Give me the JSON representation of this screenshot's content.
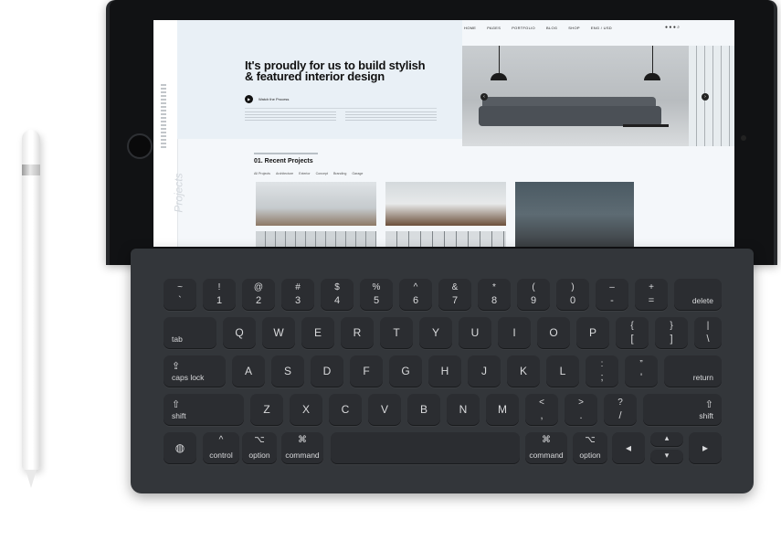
{
  "website": {
    "nav": [
      "HOME",
      "PAGES",
      "PORTFOLIO",
      "BLOG",
      "SHOP",
      "ENG / USD"
    ],
    "nav_icons": "● ● ●   ⌕",
    "hero_title": "It's proudly for us to build stylish & featured interior design",
    "watch_label": "Watch the Process",
    "play_symbol": "▶",
    "side_label": "Projects",
    "recent_title": "01. Recent Projects",
    "filters": [
      "All Projects",
      "Architecture",
      "Exterior",
      "Concept",
      "Branding",
      "Garage"
    ],
    "arrow_left": "‹",
    "arrow_right": "›"
  },
  "keyboard": {
    "row1": [
      {
        "top": "~",
        "bot": "`"
      },
      {
        "top": "!",
        "bot": "1"
      },
      {
        "top": "@",
        "bot": "2"
      },
      {
        "top": "#",
        "bot": "3"
      },
      {
        "top": "$",
        "bot": "4"
      },
      {
        "top": "%",
        "bot": "5"
      },
      {
        "top": "^",
        "bot": "6"
      },
      {
        "top": "&",
        "bot": "7"
      },
      {
        "top": "*",
        "bot": "8"
      },
      {
        "top": "(",
        "bot": "9"
      },
      {
        "top": ")",
        "bot": "0"
      },
      {
        "top": "–",
        "bot": "-"
      },
      {
        "top": "+",
        "bot": "="
      }
    ],
    "delete": "delete",
    "tab": "tab",
    "row2": [
      "Q",
      "W",
      "E",
      "R",
      "T",
      "Y",
      "U",
      "I",
      "O",
      "P"
    ],
    "brace": {
      "top": "{",
      "bot": "["
    },
    "bracket": {
      "top": "}",
      "bot": "]"
    },
    "pipe": {
      "top": "|",
      "bot": "\\"
    },
    "caps_symbol": "⇪",
    "caps": "caps lock",
    "row3": [
      "A",
      "S",
      "D",
      "F",
      "G",
      "H",
      "J",
      "K",
      "L"
    ],
    "colon": {
      "top": ":",
      "bot": ";"
    },
    "quote": {
      "top": "”",
      "bot": "'"
    },
    "return": "return",
    "shift_symbol": "⇧",
    "shift": "shift",
    "row4": [
      "Z",
      "X",
      "C",
      "V",
      "B",
      "N",
      "M"
    ],
    "lt": {
      "top": "<",
      "bot": ","
    },
    "gt": {
      "top": ">",
      "bot": "."
    },
    "qm": {
      "top": "?",
      "bot": "/"
    },
    "globe": "◍",
    "control_symbol": "^",
    "control": "control",
    "option_symbol": "⌥",
    "option": "option",
    "command_symbol": "⌘",
    "command": "command",
    "arrow_left": "◂",
    "arrow_up": "▴",
    "arrow_down": "▾",
    "arrow_right": "▸"
  }
}
